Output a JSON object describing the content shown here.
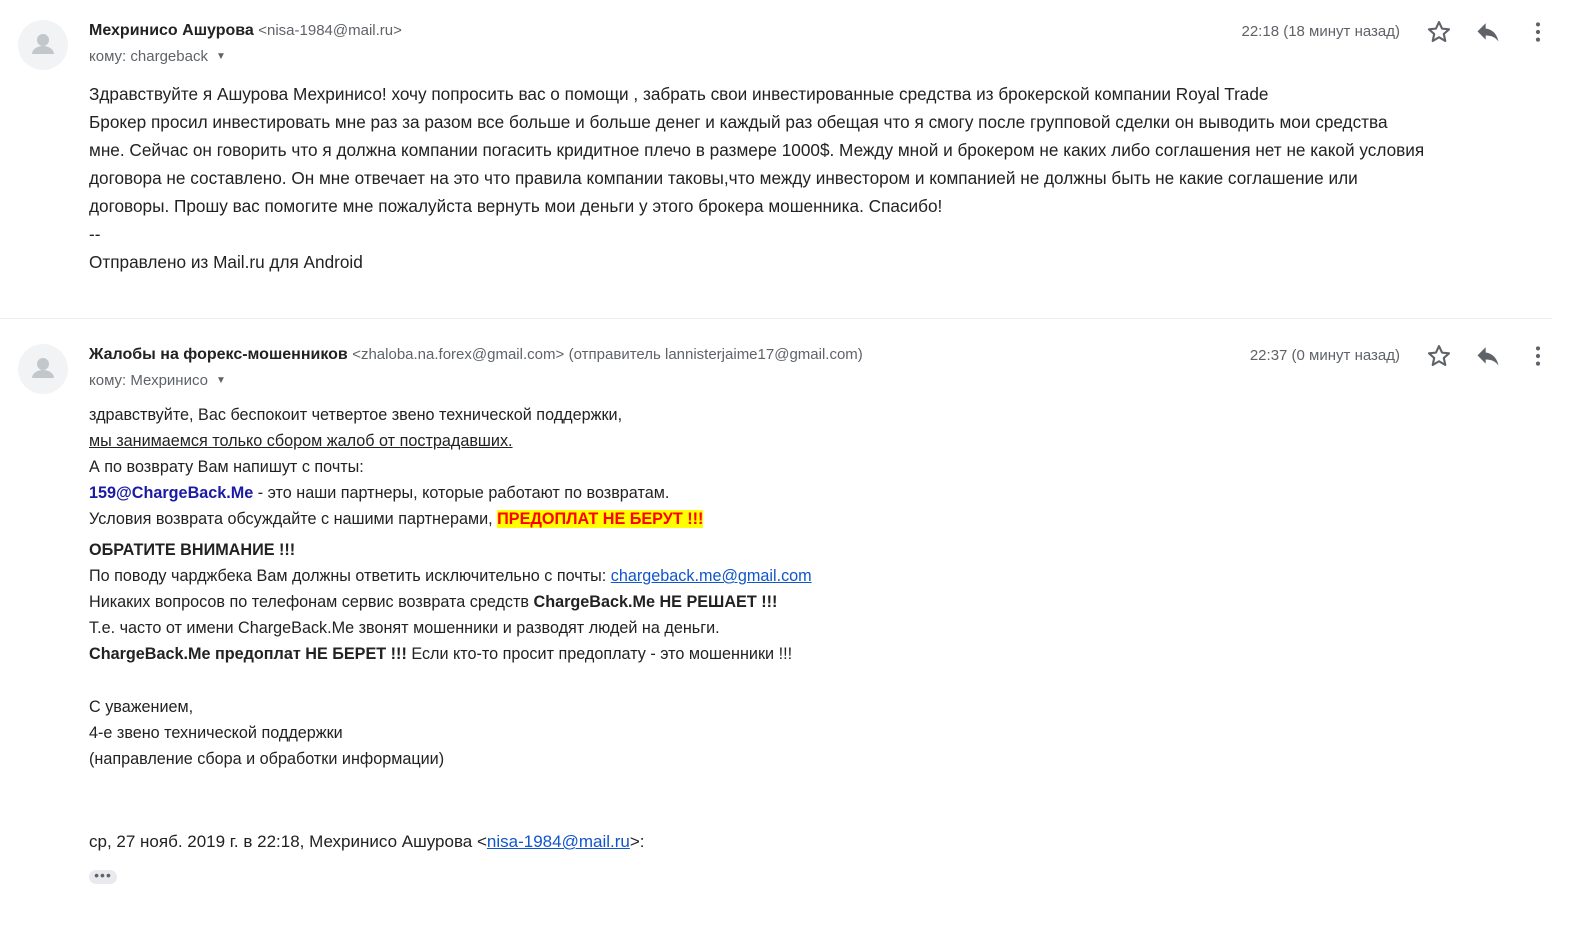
{
  "messages": [
    {
      "sender_name": "Мехринисо Ашурова",
      "sender_email": "<nisa-1984@mail.ru>",
      "sender_extra": "",
      "to_label": "кому: chargeback",
      "time": "22:18 (18 минут назад)",
      "icons": {
        "star": "star-icon",
        "reply": "reply-icon",
        "more": "more-vert-icon",
        "avatar": "person-icon"
      },
      "body_lines": [
        "Здравствуйте я Ашурова Мехринисо! хочу попросить вас о помощи , забрать свои инвестированные средства из брокерской компании Royal Trade",
        "Брокер просил инвестировать мне раз за разом все больше и больше денег и каждый раз обещая что я смогу после групповой сделки он выводить мои средства",
        "мне. Сейчас он говорить что я должна компании погасить кридитное плечо в размере 1000$. Между мной и брокером не каких либо соглашения нет не какой условия",
        "договора не составлено. Он мне отвечает на это что правила компании таковы,что между инвестором и компанией не должны быть не какие соглашение или",
        "договоры. Прошу вас помогите мне  пожалуйста вернуть мои деньги у этого брокера мошенника. Спасибо!",
        "--",
        "Отправлено из Mail.ru для Android"
      ]
    },
    {
      "sender_name": "Жалобы на форекс-мошенников",
      "sender_email": "<zhaloba.na.forex@gmail.com>",
      "sender_extra": "(отправитель lannisterjaime17@gmail.com)",
      "to_label": "кому: Мехринисо",
      "time": "22:37 (0 минут назад)",
      "body": {
        "l1": "здравствуйте, Вас беспокоит четвертое звено технической поддержки,",
        "l2": "мы занимаемся только сбором жалоб от пострадавших.",
        "l3": "А по возврату Вам напишут с почты:",
        "l4_email": "159@ChargeBack.Me",
        "l4_rest": " - это наши партнеры, которые работают по возвратам.",
        "l5_text": "Условия возврата обсуждайте с нашими партнерами, ",
        "l5_highlight": "ПРЕДОПЛАТ НЕ БЕРУТ !!!",
        "l6": "ОБРАТИТЕ ВНИМАНИЕ !!!",
        "l7_text": "По поводу чарджбека Вам должны ответить исключительно с почты: ",
        "l7_link": "chargeback.me@gmail.com",
        "l8_text": "Никаких вопросов по телефонам сервис возврата средств ",
        "l8_bold": "ChargeBack.Me НЕ РЕШАЕТ !!!",
        "l9": "Т.е. часто от имени ChargeBack.Me звонят мошенники и разводят людей на деньги.",
        "l10_bold": "ChargeBack.Me предоплат НЕ БЕРЕТ !!!",
        "l10_rest": " Если кто-то просит предоплату - это мошенники !!!",
        "sig1": "С уважением,",
        "sig2": "4-е звено технической поддержки",
        "sig3": "(направление сбора и обработки информации)",
        "quote_prefix": "ср, 27 нояб. 2019 г. в 22:18, Мехринисо Ашурова <",
        "quote_link": "nisa-1984@mail.ru",
        "quote_suffix": ">:",
        "ellipsis": "•••"
      }
    }
  ]
}
